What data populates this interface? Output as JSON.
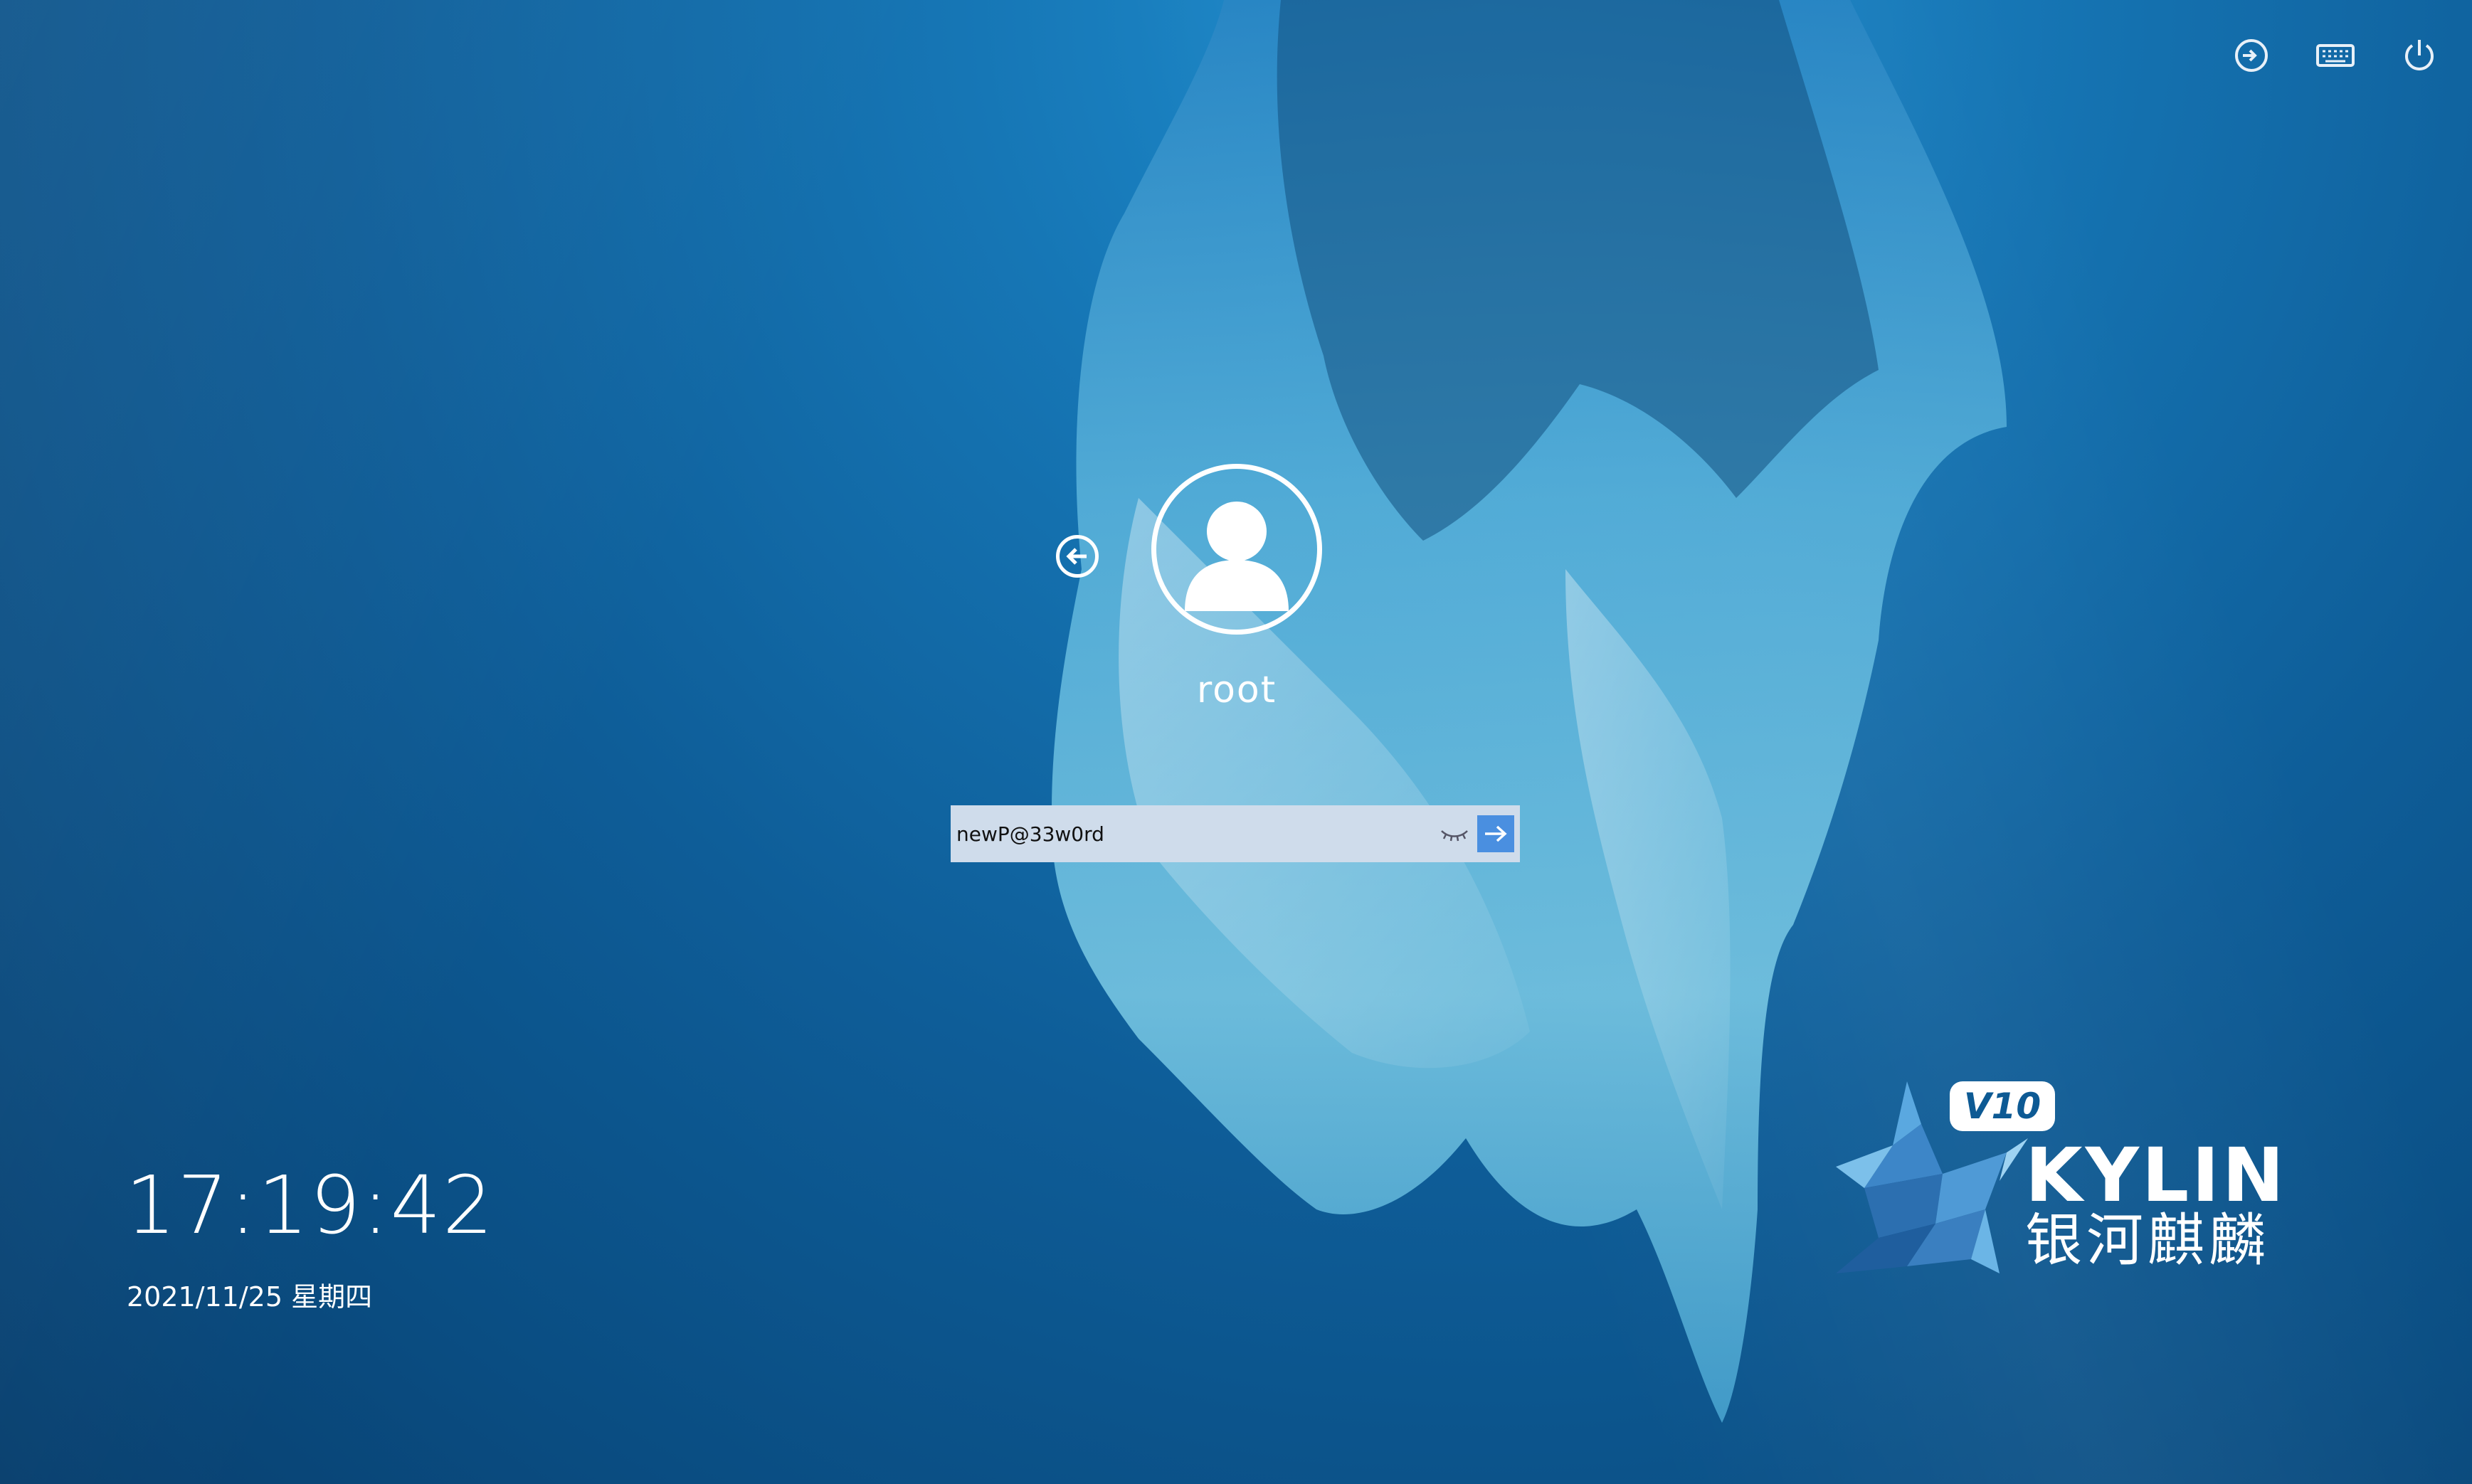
{
  "user": {
    "name": "root"
  },
  "password": {
    "value": "newP@33w0rd"
  },
  "clock": {
    "time": "17:19:42",
    "date": "2021/11/25 星期四"
  },
  "logo": {
    "version": "V10",
    "brand": "KYLIN",
    "cn_name": "银河麒麟"
  },
  "icons": {
    "top": [
      "switch-session-icon",
      "keyboard-icon",
      "power-icon"
    ],
    "back": "back-arrow-icon",
    "eye": "eye-closed-icon",
    "submit": "arrow-right-icon"
  },
  "colors": {
    "background": "#0e5d98",
    "input_bg": "#cfdceb",
    "submit_bg": "#4a8fe0",
    "text": "#ffffff"
  }
}
